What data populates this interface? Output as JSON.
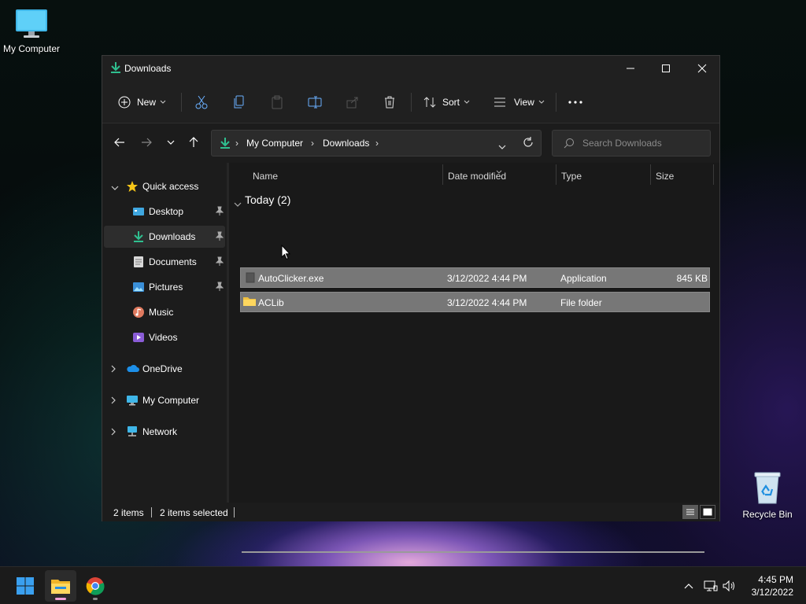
{
  "desktop": {
    "icons": [
      {
        "label": "My Computer"
      },
      {
        "label": "Recycle Bin"
      }
    ]
  },
  "window": {
    "title": "Downloads",
    "controls": {
      "minimize": "minimize",
      "maximize": "maximize",
      "close": "close"
    }
  },
  "toolbar": {
    "new_label": "New",
    "sort_label": "Sort",
    "view_label": "View",
    "icons": [
      "cut-icon",
      "copy-icon",
      "paste-icon",
      "rename-icon",
      "share-icon",
      "delete-icon",
      "more-icon"
    ]
  },
  "address": {
    "crumbs": [
      "My Computer",
      "Downloads"
    ],
    "search_placeholder": "Search Downloads"
  },
  "navpane": {
    "quick_access": "Quick access",
    "items": [
      {
        "label": "Desktop",
        "icon": "desktop-icon",
        "pinned": true
      },
      {
        "label": "Downloads",
        "icon": "download-icon",
        "pinned": true,
        "selected": true
      },
      {
        "label": "Documents",
        "icon": "documents-icon",
        "pinned": true
      },
      {
        "label": "Pictures",
        "icon": "pictures-icon",
        "pinned": true
      },
      {
        "label": "Music",
        "icon": "music-icon",
        "pinned": false
      },
      {
        "label": "Videos",
        "icon": "videos-icon",
        "pinned": false
      }
    ],
    "roots": [
      {
        "label": "OneDrive",
        "icon": "onedrive-icon"
      },
      {
        "label": "My Computer",
        "icon": "computer-icon"
      },
      {
        "label": "Network",
        "icon": "network-icon"
      }
    ]
  },
  "content": {
    "columns": [
      "Name",
      "Date modified",
      "Type",
      "Size"
    ],
    "group_label": "Today (2)",
    "files": [
      {
        "name": "AutoClicker.exe",
        "date": "3/12/2022 4:44 PM",
        "type": "Application",
        "size": "845 KB",
        "icon": "exe-icon"
      },
      {
        "name": "ACLib",
        "date": "3/12/2022 4:44 PM",
        "type": "File folder",
        "size": "",
        "icon": "folder-icon"
      }
    ]
  },
  "status": {
    "items_count": "2 items",
    "selected_count": "2 items selected"
  },
  "taskbar": {
    "apps": [
      "start-icon",
      "file-explorer-icon",
      "chrome-icon"
    ],
    "time": "4:45 PM",
    "date": "3/12/2022"
  },
  "colors": {
    "accent_green": "#2fbf8f",
    "selection_gray": "#777777",
    "window_bg": "#1c1c1c"
  }
}
